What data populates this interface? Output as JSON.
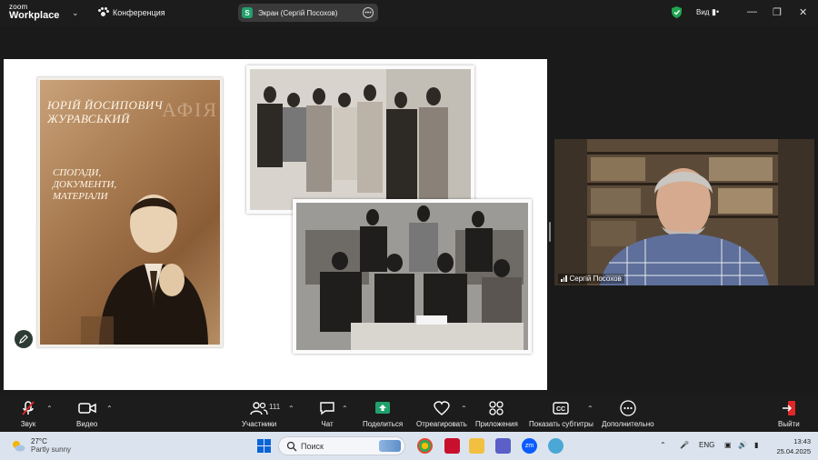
{
  "titlebar": {
    "brand_top": "zoom",
    "brand_bottom": "Workplace",
    "meeting_label": "Конференция",
    "share_pill_label": "Экран (Сергій Посохов)",
    "share_pill_icon": "S",
    "view_label": "Вид"
  },
  "book": {
    "author": "ЮРІЙ ЙОСИПОВИЧ ЖУРАВСЬКИЙ",
    "title": "СПОГАДИ, ДОКУМЕНТИ, МАТЕРІАЛИ",
    "bg_text": "АФІЯ"
  },
  "video": {
    "participant_name": "Сергій Посохов"
  },
  "toolbar": {
    "audio": "Звук",
    "video": "Видео",
    "participants": "Участники",
    "participants_count": "111",
    "chat": "Чат",
    "share": "Поделиться",
    "react": "Отреагировать",
    "apps": "Приложения",
    "captions": "Показать субтитры",
    "more": "Дополнительно",
    "leave": "Выйти",
    "share_color": "#22a06b",
    "leave_color": "#e02828"
  },
  "taskbar": {
    "temperature": "27°C",
    "weather": "Partly sunny",
    "search_placeholder": "Поиск",
    "lang": "ENG",
    "time": "13:43",
    "date": "25.04.2025"
  }
}
